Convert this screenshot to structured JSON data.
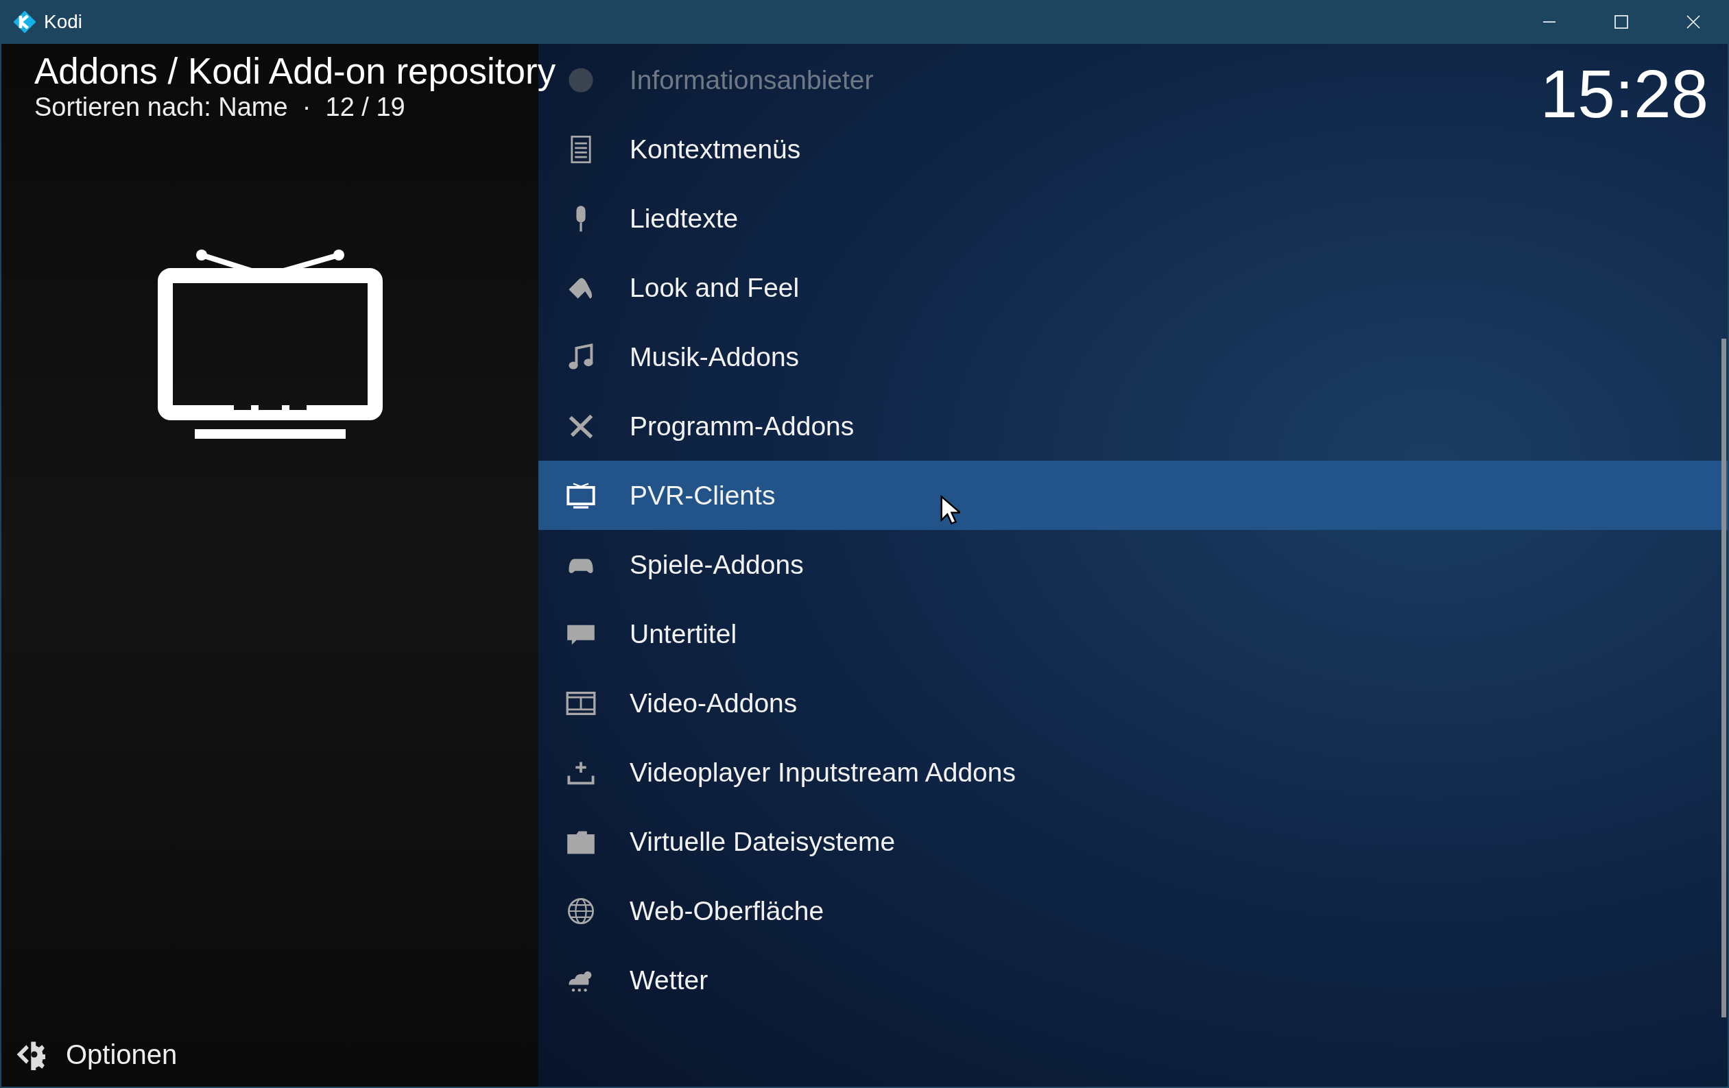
{
  "window": {
    "title": "Kodi"
  },
  "header": {
    "title": "Addons / Kodi Add-on repository",
    "subtitle": "Sortieren nach: Name  ·  12 / 19",
    "clock": "15:28"
  },
  "items": [
    {
      "label": "Informationsanbieter",
      "selected": false,
      "dimmed": true
    },
    {
      "label": "Kontextmenüs",
      "selected": false,
      "dimmed": false
    },
    {
      "label": "Liedtexte",
      "selected": false,
      "dimmed": false
    },
    {
      "label": "Look and Feel",
      "selected": false,
      "dimmed": false
    },
    {
      "label": "Musik-Addons",
      "selected": false,
      "dimmed": false
    },
    {
      "label": "Programm-Addons",
      "selected": false,
      "dimmed": false
    },
    {
      "label": "PVR-Clients",
      "selected": true,
      "dimmed": false
    },
    {
      "label": "Spiele-Addons",
      "selected": false,
      "dimmed": false
    },
    {
      "label": "Untertitel",
      "selected": false,
      "dimmed": false
    },
    {
      "label": "Video-Addons",
      "selected": false,
      "dimmed": false
    },
    {
      "label": "Videoplayer Inputstream Addons",
      "selected": false,
      "dimmed": false
    },
    {
      "label": "Virtuelle Dateisysteme",
      "selected": false,
      "dimmed": false
    },
    {
      "label": "Web-Oberfläche",
      "selected": false,
      "dimmed": false
    },
    {
      "label": "Wetter",
      "selected": false,
      "dimmed": false
    }
  ],
  "options": {
    "label": "Optionen"
  }
}
